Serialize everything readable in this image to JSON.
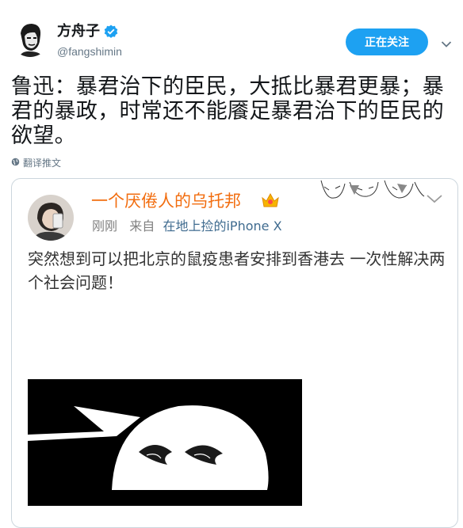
{
  "author": {
    "name": "方舟子",
    "handle": "@fangshimin",
    "verified_icon": "verified-badge-icon"
  },
  "follow_button_label": "正在关注",
  "tweet": {
    "text": "鲁迅：暴君治下的臣民，大抵比暴君更暴；暴君的暴政，时常还不能餍足暴君治下的臣民的欲望。",
    "translate_label": "翻译推文"
  },
  "embedded_post": {
    "user_name": "一个厌倦人的乌托邦",
    "time": "刚刚",
    "from_label": "来自",
    "source": "在地上捡的iPhone X",
    "text": "突然想到可以把北京的鼠疫患者安排到香港去 一次性解决两个社会问题！",
    "image": "meme-image"
  },
  "colors": {
    "accent": "#1da1f2",
    "weibo_name": "#f26d0f",
    "weibo_source": "#3f6b8f"
  }
}
